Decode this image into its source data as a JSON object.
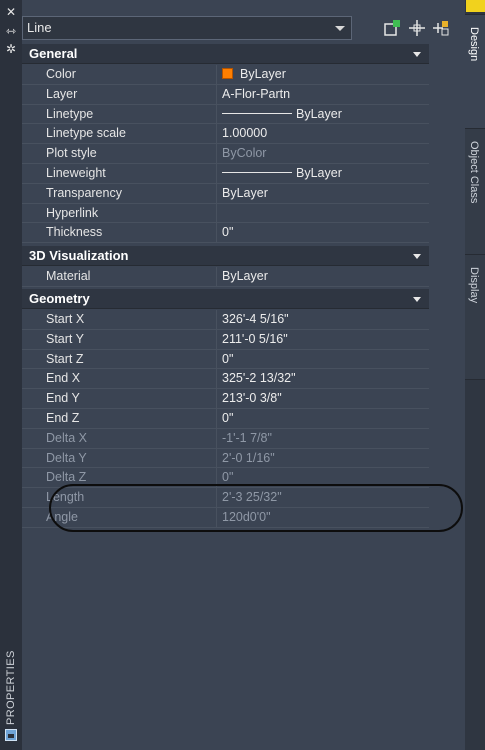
{
  "panel_title": "PROPERTIES",
  "selector": {
    "value": "Line"
  },
  "sections": {
    "general": {
      "title": "General",
      "rows": [
        {
          "label": "Color",
          "value": "ByLayer"
        },
        {
          "label": "Layer",
          "value": "A-Flor-Partn"
        },
        {
          "label": "Linetype",
          "value": "ByLayer"
        },
        {
          "label": "Linetype scale",
          "value": "1.00000"
        },
        {
          "label": "Plot style",
          "value": "ByColor"
        },
        {
          "label": "Lineweight",
          "value": "ByLayer"
        },
        {
          "label": "Transparency",
          "value": "ByLayer"
        },
        {
          "label": "Hyperlink",
          "value": ""
        },
        {
          "label": "Thickness",
          "value": "0\""
        }
      ]
    },
    "viz3d": {
      "title": "3D Visualization",
      "rows": [
        {
          "label": "Material",
          "value": "ByLayer"
        }
      ]
    },
    "geometry": {
      "title": "Geometry",
      "rows": [
        {
          "label": "Start X",
          "value": "326'-4 5/16\""
        },
        {
          "label": "Start Y",
          "value": "211'-0 5/16\""
        },
        {
          "label": "Start Z",
          "value": "0\""
        },
        {
          "label": "End X",
          "value": "325'-2 13/32\""
        },
        {
          "label": "End Y",
          "value": "213'-0 3/8\""
        },
        {
          "label": "End Z",
          "value": "0\""
        },
        {
          "label": "Delta X",
          "value": "-1'-1 7/8\""
        },
        {
          "label": "Delta Y",
          "value": "2'-0 1/16\""
        },
        {
          "label": "Delta Z",
          "value": "0\""
        },
        {
          "label": "Length",
          "value": "2'-3 25/32\""
        },
        {
          "label": "Angle",
          "value": "120d0'0\""
        }
      ]
    }
  },
  "tabs": [
    "Design",
    "Object Class",
    "Display"
  ],
  "icons": {
    "close": "close-icon",
    "autohide": "autohide-icon",
    "settings": "gear-icon",
    "quick_select": "quick-select-icon",
    "select_objects": "select-objects-icon",
    "toggle_pickadd": "pickadd-icon"
  },
  "colors": {
    "accent": "#f1d21d",
    "bylayer_swatch": "#ff7f00"
  }
}
